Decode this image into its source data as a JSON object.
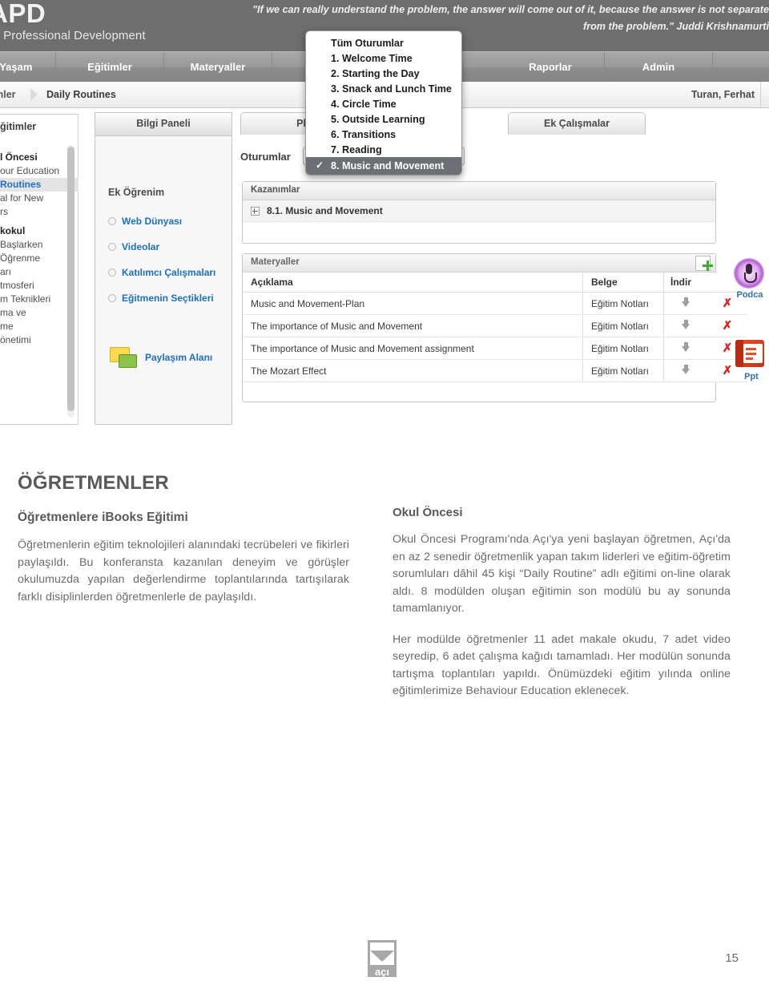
{
  "screenshot": {
    "brand": {
      "logo_text": "APD",
      "subtitle": "çı Professional Development"
    },
    "quote": {
      "line1": "\"If we can really understand the problem, the answer will come out of it, because the answer is not separate",
      "line2": "from the problem.\" Juddi Krishnamurti"
    },
    "nav": [
      {
        "label": "e Yaşam"
      },
      {
        "label": "Eğitimler"
      },
      {
        "label": "Materyaller"
      },
      {
        "label": ""
      },
      {
        "label": "Raporlar"
      },
      {
        "label": "Admin"
      }
    ],
    "breadcrumb": {
      "parent": "itimler",
      "current": "Daily Routines",
      "user": "Turan, Ferhat"
    },
    "tabs": [
      {
        "label": "Bilgi Paneli"
      },
      {
        "label": "Planl"
      },
      {
        "label": "Ek Çalışmalar"
      }
    ],
    "sidebar": {
      "heading": "ğitimler",
      "items": [
        {
          "label": "l Öncesi",
          "type": "group"
        },
        {
          "label": "our Education",
          "type": "item"
        },
        {
          "label": "Routines",
          "type": "selected"
        },
        {
          "label": "al for New",
          "type": "item"
        },
        {
          "label": "rs",
          "type": "item"
        },
        {
          "label": "kokul",
          "type": "group"
        },
        {
          "label": "Başlarken",
          "type": "item"
        },
        {
          "label": "Öğrenme",
          "type": "item"
        },
        {
          "label": "arı",
          "type": "item"
        },
        {
          "label": "tmosferi",
          "type": "item"
        },
        {
          "label": "m Teknikleri",
          "type": "item"
        },
        {
          "label": "ma ve",
          "type": "item"
        },
        {
          "label": "me",
          "type": "item"
        },
        {
          "label": "önetimi",
          "type": "item"
        }
      ]
    },
    "info_panel": {
      "title": "Bilgi Paneli",
      "section_title": "Ek Öğrenim",
      "links": [
        {
          "label": "Web Dünyası"
        },
        {
          "label": "Videolar"
        },
        {
          "label": "Katılımcı Çalışmaları"
        },
        {
          "label": "Eğitmenin Seçtikleri"
        }
      ],
      "share_label": "Paylaşım Alanı"
    },
    "sessions": {
      "label": "Oturumlar",
      "dropdown_header": "Tüm Oturumlar",
      "options": [
        {
          "label": "1. Welcome Time",
          "selected": false
        },
        {
          "label": "2. Starting the Day",
          "selected": false
        },
        {
          "label": "3. Snack and Lunch Time",
          "selected": false
        },
        {
          "label": "4. Circle Time",
          "selected": false
        },
        {
          "label": "5. Outside Learning",
          "selected": false
        },
        {
          "label": "6. Transitions",
          "selected": false
        },
        {
          "label": "7. Reading",
          "selected": false
        },
        {
          "label": "8. Music and Movement",
          "selected": true
        }
      ],
      "check_glyph": "✓"
    },
    "outcomes": {
      "title": "Kazanımlar",
      "rows": [
        {
          "label": "8.1. Music and Movement"
        }
      ]
    },
    "materials": {
      "title": "Materyaller",
      "columns": [
        "Açıklama",
        "Belge",
        "İndir",
        ""
      ],
      "rows": [
        {
          "description": "Music and Movement-Plan",
          "document": "Eğitim Notları"
        },
        {
          "description": "The importance of Music and Movement",
          "document": "Eğitim Notları"
        },
        {
          "description": "The importance of Music and Movement assignment",
          "document": "Eğitim Notları"
        },
        {
          "description": "The Mozart Effect",
          "document": "Eğitim Notları"
        }
      ],
      "delete_glyph": "✗"
    },
    "right_icons": [
      {
        "label": "Podca"
      },
      {
        "label": "Ppt"
      }
    ]
  },
  "article": {
    "kicker": "ÖĞRETMENLER",
    "left": {
      "heading": "Öğretmenlere iBooks Eğitimi",
      "paragraph": "Öğretmenlerin eğitim teknolojileri alanındaki tecrübeleri ve fikirleri paylaşıldı. Bu konferansta kazanılan deneyim ve görüşler okulumuzda yapılan değerlendirme toplantılarında tartışılarak farklı disiplinlerden öğretmenlerle de paylaşıldı."
    },
    "right": {
      "heading": "Okul Öncesi",
      "paragraph1": "Okul Öncesi Programı'nda Açı'ya yeni başlayan öğretmen, Açı'da en az 2 senedir öğretmenlik yapan takım liderleri ve eğitim-öğretim sorumluları dâhil 45 kişi “Daily Routine” adlı eğitimi on-line olarak aldı. 8 modülden oluşan eğitimin son modülü bu ay sonunda tamamlanıyor.",
      "paragraph2": "Her modülde öğretmenler 11 adet makale okudu, 7 adet video seyredip, 6 adet çalışma kağıdı tamamladı. Her modülün sonunda tartışma toplantıları yapıldı. Önümüzdeki eğitim yılında online eğitimlerimize Behaviour Education eklenecek."
    }
  },
  "footer": {
    "logo_text": "açı",
    "page_number": "15"
  }
}
